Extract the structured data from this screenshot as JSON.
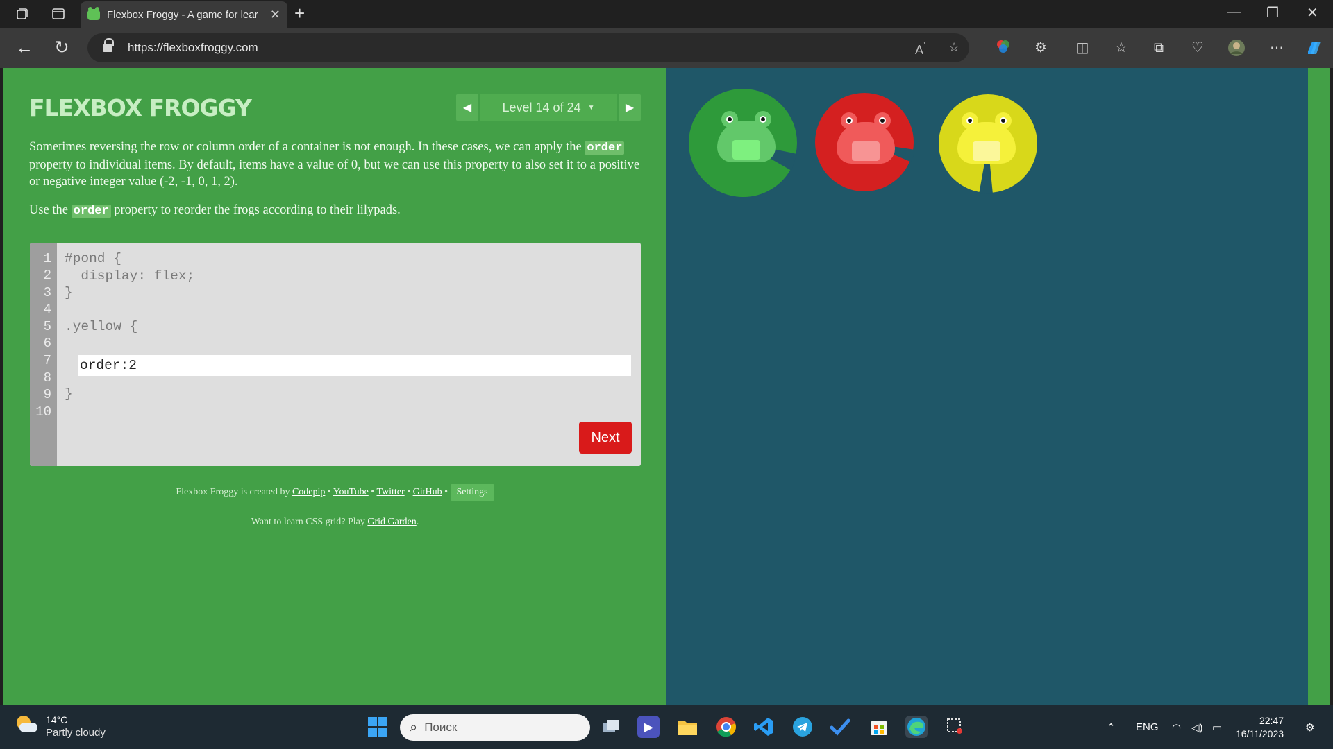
{
  "browser": {
    "tab_title": "Flexbox Froggy - A game for lear",
    "url": "https://flexboxfroggy.com"
  },
  "page": {
    "logo": "FLEXBOX FROGGY",
    "level_label": "Level 14 of 24",
    "level_current": 14,
    "level_total": 24,
    "instructions": {
      "p1_before": "Sometimes reversing the row or column order of a container is not enough. In these cases, we can apply the",
      "p1_code": "order",
      "p1_after": "property to individual items. By default, items have a value of 0, but we can use this property to also set it to a positive or negative integer value (-2, -1, 0, 1, 2).",
      "p2_before": "Use the",
      "p2_code": "order",
      "p2_after": "property to reorder the frogs according to their lilypads."
    },
    "editor": {
      "line_numbers": [
        "1",
        "2",
        "3",
        "4",
        "5",
        "6",
        "7",
        "8",
        "9",
        "10"
      ],
      "line1": "#pond {",
      "line2": "  display: flex;",
      "line3": "}",
      "line5": ".yellow {",
      "input_value": "order:2",
      "line7": "}",
      "next_label": "Next"
    },
    "credits": {
      "prefix": "Flexbox Froggy is created by",
      "codepip": "Codepip",
      "youtube": "YouTube",
      "twitter": "Twitter",
      "github": "GitHub",
      "sep": "•",
      "settings": "Settings"
    },
    "promo": {
      "prefix": "Want to learn CSS grid? Play",
      "link": "Grid Garden",
      "suffix": "."
    },
    "pond": {
      "colors": {
        "green_pad": "#2e9a3a",
        "red_pad": "#d42020",
        "yellow_pad": "#d8d81a",
        "green_frog": "#62c86a",
        "red_frog": "#f05a5a",
        "yellow_frog": "#f5f13a"
      }
    }
  },
  "taskbar": {
    "weather_temp": "14°C",
    "weather_desc": "Partly cloudy",
    "search_placeholder": "Поиск",
    "lang": "ENG",
    "time": "22:47",
    "date": "16/11/2023"
  }
}
